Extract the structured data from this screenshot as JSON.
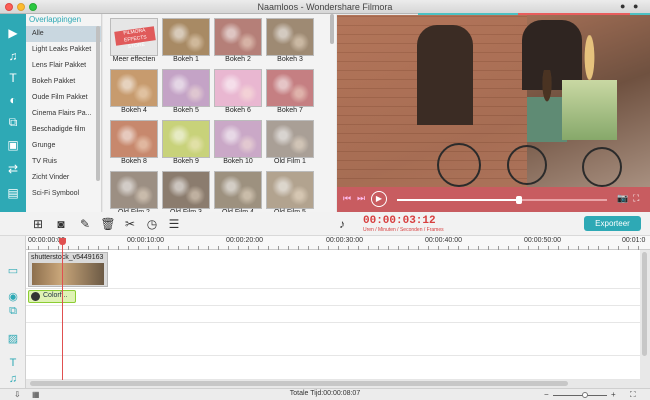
{
  "window": {
    "title": "Naamloos - Wondershare Filmora"
  },
  "categories": {
    "header": "Overlappingen",
    "items": [
      "Alle",
      "Light Leaks Pakket",
      "Lens Flair Pakket",
      "Bokeh Pakket",
      "Oude Film Pakket",
      "Cinema Flairs Pa...",
      "Beschadigde film",
      "Grunge",
      "TV Ruis",
      "Zicht Vinder",
      "Sci-Fi Symbool"
    ]
  },
  "thumbnails": {
    "labels": [
      "Meer effecten",
      "Bokeh 1",
      "Bokeh 2",
      "Bokeh 3",
      "Bokeh 4",
      "Bokeh 5",
      "Bokeh 6",
      "Bokeh 7",
      "Bokeh 8",
      "Bokeh 9",
      "Bokeh 10",
      "Old Film 1",
      "Old Film 2",
      "Old Film 3",
      "Old Film 4",
      "Old Film 5"
    ],
    "promo_text": "FILMORA EFFECTS STORE",
    "colors": [
      "#e8e8e8",
      "#a88a64",
      "#b57f78",
      "#9e8a73",
      "#c79b6e",
      "#c4a3c6",
      "#e9b7d1",
      "#c57f82",
      "#c7886d",
      "#c8d27a",
      "#caa8c7",
      "#a99f96",
      "#9c8f83",
      "#8b7c6e",
      "#9d917f",
      "#b2a38f"
    ]
  },
  "player": {
    "progress": 0.58,
    "controls": {
      "rewind": "⏮",
      "forward": "⏭",
      "play": "▶",
      "snapshot": "📷",
      "fullscreen": "⛶"
    }
  },
  "toolbar": {
    "timecode": "00:00:03:12",
    "timecode_sub": "Uren / Minuten / Seconden / Frames",
    "export_label": "Exporteer"
  },
  "ruler": {
    "ticks": [
      "00:00:00:00",
      "00:00:10:00",
      "00:00:20:00",
      "00:00:30:00",
      "00:00:40:00",
      "00:00:50:00",
      "00:01:0"
    ]
  },
  "timeline": {
    "video_clip": "shutterstock_v5449163",
    "overlay_clip": "Colorf..."
  },
  "status": {
    "total": "Totale Tijd:00:00:08:07"
  }
}
